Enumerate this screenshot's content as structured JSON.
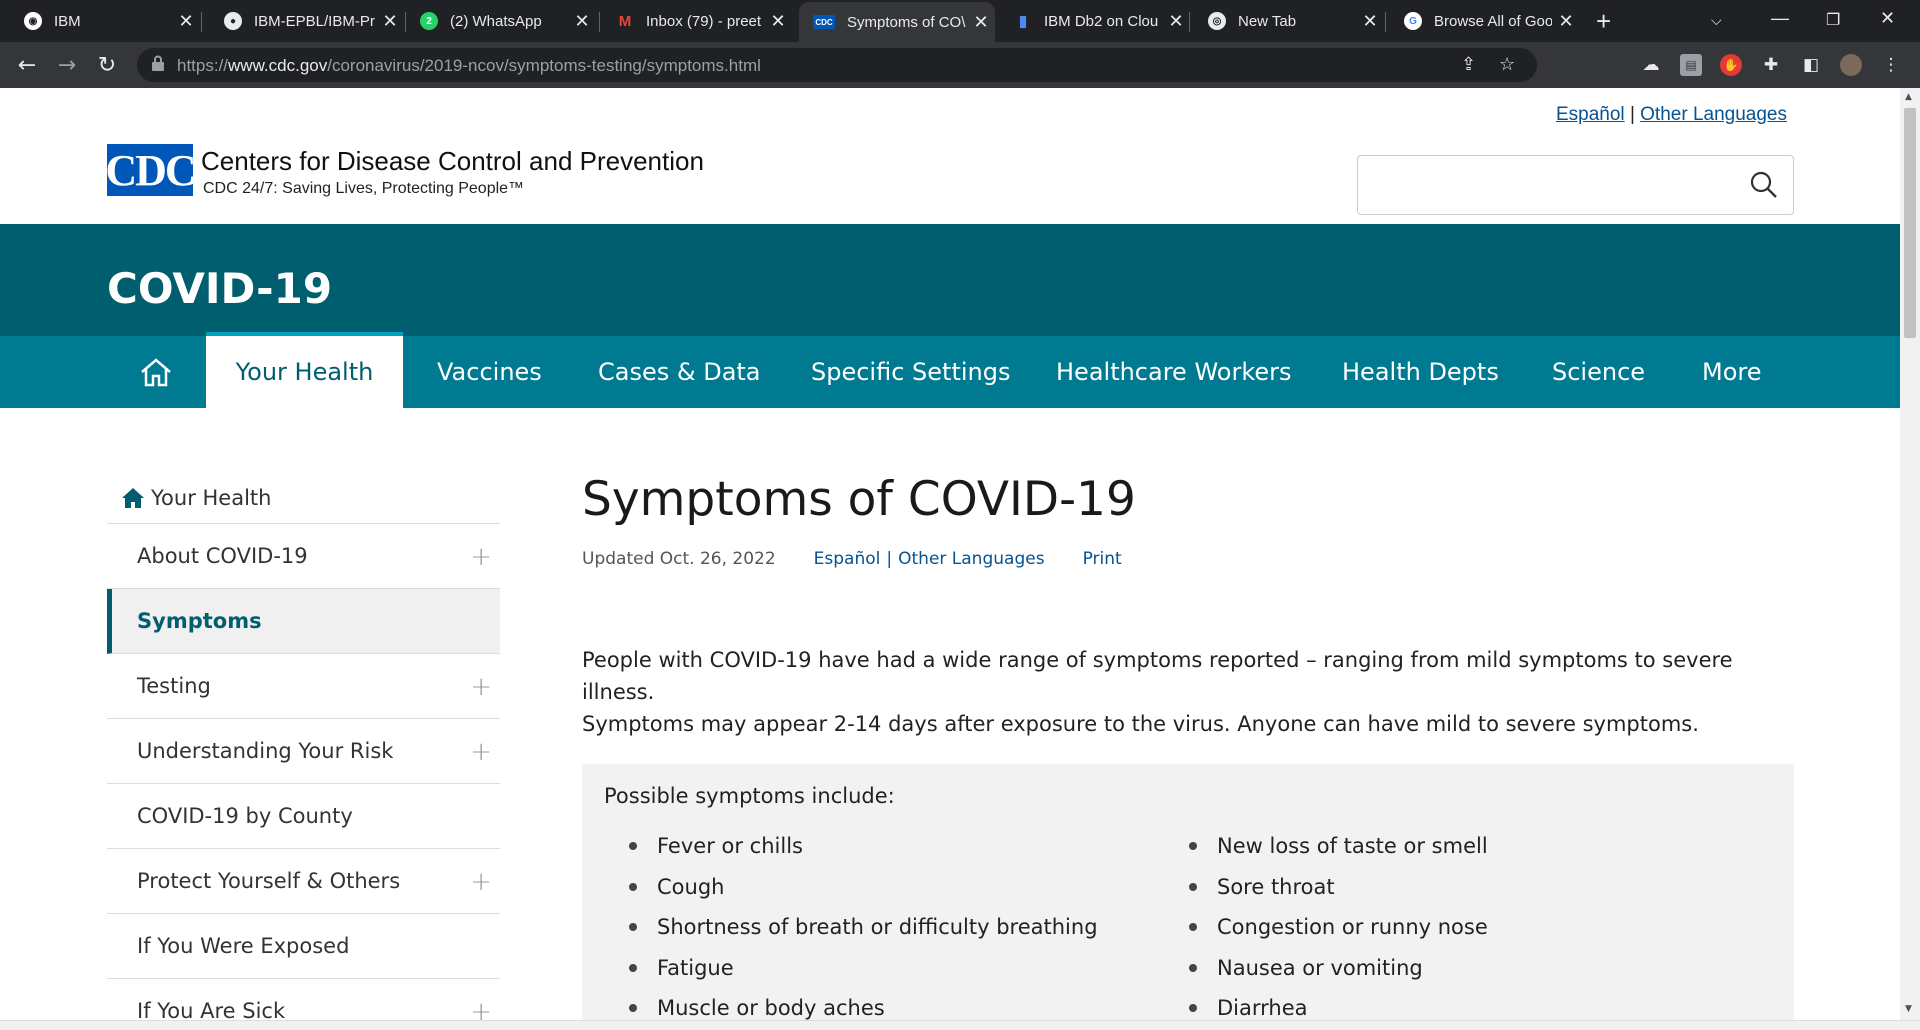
{
  "browser": {
    "tabs": [
      {
        "title": "IBM",
        "favicon": "ibm-icon",
        "active": false
      },
      {
        "title": "IBM-EPBL/IBM-Pr",
        "favicon": "github-icon",
        "active": false
      },
      {
        "title": "(2) WhatsApp",
        "favicon": "whatsapp-icon",
        "active": false
      },
      {
        "title": "Inbox (79) - preet",
        "favicon": "gmail-icon",
        "active": false
      },
      {
        "title": "Symptoms of CO\\",
        "favicon": "cdc-icon",
        "active": true
      },
      {
        "title": "IBM Db2 on Clou",
        "favicon": "db2-icon",
        "active": false
      },
      {
        "title": "New Tab",
        "favicon": "chrome-icon",
        "active": false
      },
      {
        "title": "Browse All of Goo",
        "favicon": "google-icon",
        "active": false
      }
    ],
    "url_prefix": "https://",
    "url_host": "www.cdc.gov",
    "url_path": "/coronavirus/2019-ncov/symptoms-testing/symptoms.html"
  },
  "header": {
    "lang_espanol": "Español",
    "lang_sep": "|",
    "lang_other": "Other Languages",
    "logo_mark": "CDC",
    "org_name": "Centers for Disease Control and Prevention",
    "tagline": "CDC 24/7: Saving Lives, Protecting People™",
    "search_placeholder": ""
  },
  "banner": {
    "title": "COVID-19"
  },
  "mainnav": {
    "items": [
      "Your Health",
      "Vaccines",
      "Cases & Data",
      "Specific Settings",
      "Healthcare Workers",
      "Health Depts",
      "Science",
      "More"
    ],
    "active": "Your Health"
  },
  "sidenav": {
    "top": "Your Health",
    "items": [
      {
        "label": "About COVID-19",
        "expandable": true
      },
      {
        "label": "Symptoms",
        "expandable": false,
        "selected": true
      },
      {
        "label": "Testing",
        "expandable": true
      },
      {
        "label": "Understanding Your Risk",
        "expandable": true
      },
      {
        "label": "COVID-19 by County",
        "expandable": false
      },
      {
        "label": "Protect Yourself & Others",
        "expandable": true
      },
      {
        "label": "If You Were Exposed",
        "expandable": false
      },
      {
        "label": "If You Are Sick",
        "expandable": true
      }
    ]
  },
  "content": {
    "title": "Symptoms of COVID-19",
    "updated": "Updated Oct. 26, 2022",
    "espanol": "Español",
    "sep": "|",
    "other_languages": "Other Languages",
    "print": "Print",
    "intro_line1": "People with COVID-19 have had a wide range of symptoms reported – ranging from mild symptoms to severe illness.",
    "intro_line2": "Symptoms may appear 2-14 days after exposure to the virus. Anyone can have mild to severe symptoms.",
    "callout_label": "Possible symptoms include:",
    "symptoms_left": [
      "Fever or chills",
      "Cough",
      "Shortness of breath or difficulty breathing",
      "Fatigue",
      "Muscle or body aches"
    ],
    "symptoms_right": [
      "New loss of taste or smell",
      "Sore throat",
      "Congestion or runny nose",
      "Nausea or vomiting",
      "Diarrhea"
    ]
  },
  "colors": {
    "banner": "#005e6e",
    "nav": "#007a91",
    "link": "#075290",
    "cdc_blue": "#0057b7"
  }
}
